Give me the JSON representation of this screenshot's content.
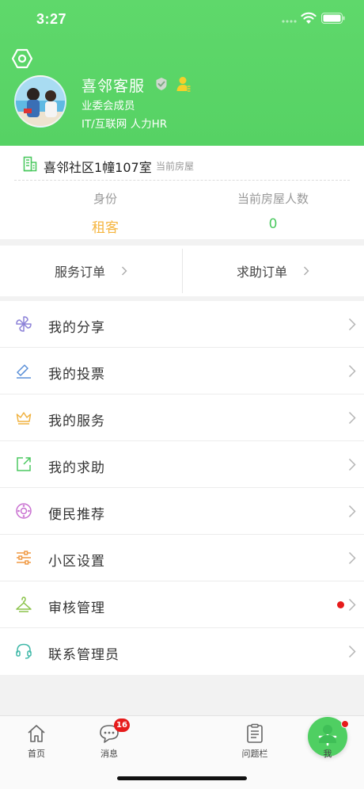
{
  "status_bar": {
    "time": "3:27"
  },
  "profile": {
    "name": "喜邻客服",
    "role": "业委会成员",
    "tags": "IT/互联网 人力HR"
  },
  "house": {
    "community": "喜邻社区1幢107室",
    "tag": "当前房屋",
    "identity_label": "身份",
    "identity_value": "租客",
    "residents_label": "当前房屋人数",
    "residents_value": "0"
  },
  "orders": {
    "service": "服务订单",
    "help": "求助订单"
  },
  "menu": {
    "items": [
      {
        "label": "我的分享",
        "icon": "pinwheel-icon"
      },
      {
        "label": "我的投票",
        "icon": "ticket-icon"
      },
      {
        "label": "我的服务",
        "icon": "crown-icon"
      },
      {
        "label": "我的求助",
        "icon": "external-link-icon"
      },
      {
        "label": "便民推荐",
        "icon": "lifebuoy-icon"
      },
      {
        "label": "小区设置",
        "icon": "sliders-icon"
      },
      {
        "label": "审核管理",
        "icon": "hanger-icon",
        "has_dot": true
      },
      {
        "label": "联系管理员",
        "icon": "headset-icon"
      }
    ]
  },
  "tabbar": {
    "home": "首页",
    "messages": "消息",
    "messages_badge": "16",
    "issues": "问题栏",
    "me": "我"
  },
  "colors": {
    "header_green": "#56d264",
    "accent_green": "#4cc960",
    "tenant_orange": "#f5b53f",
    "badge_red": "#e61b1b"
  }
}
